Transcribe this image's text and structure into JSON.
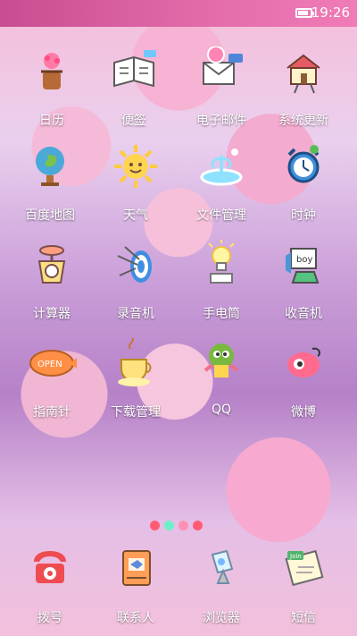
{
  "status_bar": {
    "time": "19:26",
    "battery_level": 0.72,
    "color_start": "#c84c91",
    "color_end": "#f07cb7"
  },
  "apps": [
    {
      "id": "calendar",
      "label": "日历",
      "icon": "calendar-icon"
    },
    {
      "id": "notes",
      "label": "便签",
      "icon": "notebook-icon"
    },
    {
      "id": "email",
      "label": "电子邮件",
      "icon": "mail-icon"
    },
    {
      "id": "system-update",
      "label": "系统更新",
      "icon": "house-icon"
    },
    {
      "id": "baidu-map",
      "label": "百度地图",
      "icon": "globe-icon"
    },
    {
      "id": "weather",
      "label": "天气",
      "icon": "sun-icon"
    },
    {
      "id": "file-manager",
      "label": "文件管理",
      "icon": "fountain-icon"
    },
    {
      "id": "clock",
      "label": "时钟",
      "icon": "alarm-clock-icon"
    },
    {
      "id": "calculator",
      "label": "计算器",
      "icon": "scale-icon"
    },
    {
      "id": "recorder",
      "label": "录音机",
      "icon": "target-icon"
    },
    {
      "id": "flashlight",
      "label": "手电筒",
      "icon": "lightbulb-icon"
    },
    {
      "id": "radio",
      "label": "收音机",
      "icon": "boy-screen-icon"
    },
    {
      "id": "compass",
      "label": "指南针",
      "icon": "blimp-icon"
    },
    {
      "id": "download-manager",
      "label": "下载管理",
      "icon": "teacup-icon"
    },
    {
      "id": "qq",
      "label": "QQ",
      "icon": "bird-icon"
    },
    {
      "id": "weibo",
      "label": "微博",
      "icon": "weibo-face-icon"
    }
  ],
  "dock": [
    {
      "id": "dialer",
      "label": "拨号",
      "icon": "telephone-icon"
    },
    {
      "id": "contacts",
      "label": "联系人",
      "icon": "contact-book-icon"
    },
    {
      "id": "browser",
      "label": "浏览器",
      "icon": "satellite-icon"
    },
    {
      "id": "messages",
      "label": "短信",
      "icon": "join-sign-icon"
    }
  ],
  "page_indicator": {
    "colors": [
      "#ff5c74",
      "#6ef0c8",
      "#ff8fb5",
      "#ff5c74"
    ]
  }
}
